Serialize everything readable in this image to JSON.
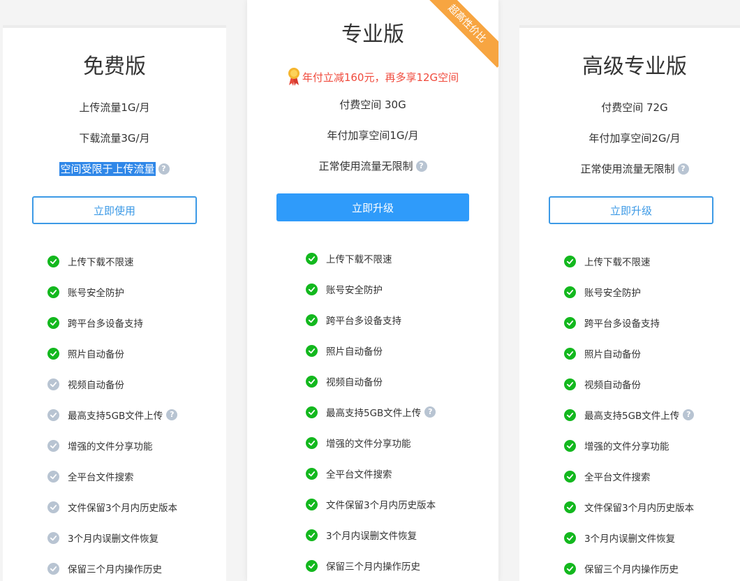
{
  "plans": [
    {
      "title": "免费版",
      "specs": [
        "上传流量1G/月",
        "下载流量3G/月",
        "空间受限于上传流量"
      ],
      "button": "立即使用",
      "features": [
        {
          "label": "上传下载不限速",
          "enabled": true
        },
        {
          "label": "账号安全防护",
          "enabled": true
        },
        {
          "label": "跨平台多设备支持",
          "enabled": true
        },
        {
          "label": "照片自动备份",
          "enabled": true
        },
        {
          "label": "视频自动备份",
          "enabled": false
        },
        {
          "label": "最高支持5GB文件上传",
          "enabled": false
        },
        {
          "label": "增强的文件分享功能",
          "enabled": false
        },
        {
          "label": "全平台文件搜索",
          "enabled": false
        },
        {
          "label": "文件保留3个月内历史版本",
          "enabled": false
        },
        {
          "label": "3个月内误删文件恢复",
          "enabled": false
        },
        {
          "label": "保留三个月内操作历史",
          "enabled": false
        }
      ]
    },
    {
      "title": "专业版",
      "ribbon": "超高性价比",
      "promo": "年付立减160元，再多享12G空间",
      "specs": [
        "付费空间 30G",
        "年付加享空间1G/月",
        "正常使用流量无限制"
      ],
      "button": "立即升级",
      "features": [
        {
          "label": "上传下载不限速",
          "enabled": true
        },
        {
          "label": "账号安全防护",
          "enabled": true
        },
        {
          "label": "跨平台多设备支持",
          "enabled": true
        },
        {
          "label": "照片自动备份",
          "enabled": true
        },
        {
          "label": "视频自动备份",
          "enabled": true
        },
        {
          "label": "最高支持5GB文件上传",
          "enabled": true
        },
        {
          "label": "增强的文件分享功能",
          "enabled": true
        },
        {
          "label": "全平台文件搜索",
          "enabled": true
        },
        {
          "label": "文件保留3个月内历史版本",
          "enabled": true
        },
        {
          "label": "3个月内误删文件恢复",
          "enabled": true
        },
        {
          "label": "保留三个月内操作历史",
          "enabled": true
        }
      ]
    },
    {
      "title": "高级专业版",
      "specs": [
        "付费空间 72G",
        "年付加享空间2G/月",
        "正常使用流量无限制"
      ],
      "button": "立即升级",
      "features": [
        {
          "label": "上传下载不限速",
          "enabled": true
        },
        {
          "label": "账号安全防护",
          "enabled": true
        },
        {
          "label": "跨平台多设备支持",
          "enabled": true
        },
        {
          "label": "照片自动备份",
          "enabled": true
        },
        {
          "label": "视频自动备份",
          "enabled": true
        },
        {
          "label": "最高支持5GB文件上传",
          "enabled": true
        },
        {
          "label": "增强的文件分享功能",
          "enabled": true
        },
        {
          "label": "全平台文件搜索",
          "enabled": true
        },
        {
          "label": "文件保留3个月内历史版本",
          "enabled": true
        },
        {
          "label": "3个月内误删文件恢复",
          "enabled": true
        },
        {
          "label": "保留三个月内操作历史",
          "enabled": true
        }
      ]
    }
  ],
  "help_icon": "question-icon",
  "colors": {
    "enabled": "#13b81e",
    "disabled": "#b8c4d2",
    "accent": "#2f9bfa",
    "promo": "#f04a3c",
    "ribbon": "#f7a541"
  }
}
